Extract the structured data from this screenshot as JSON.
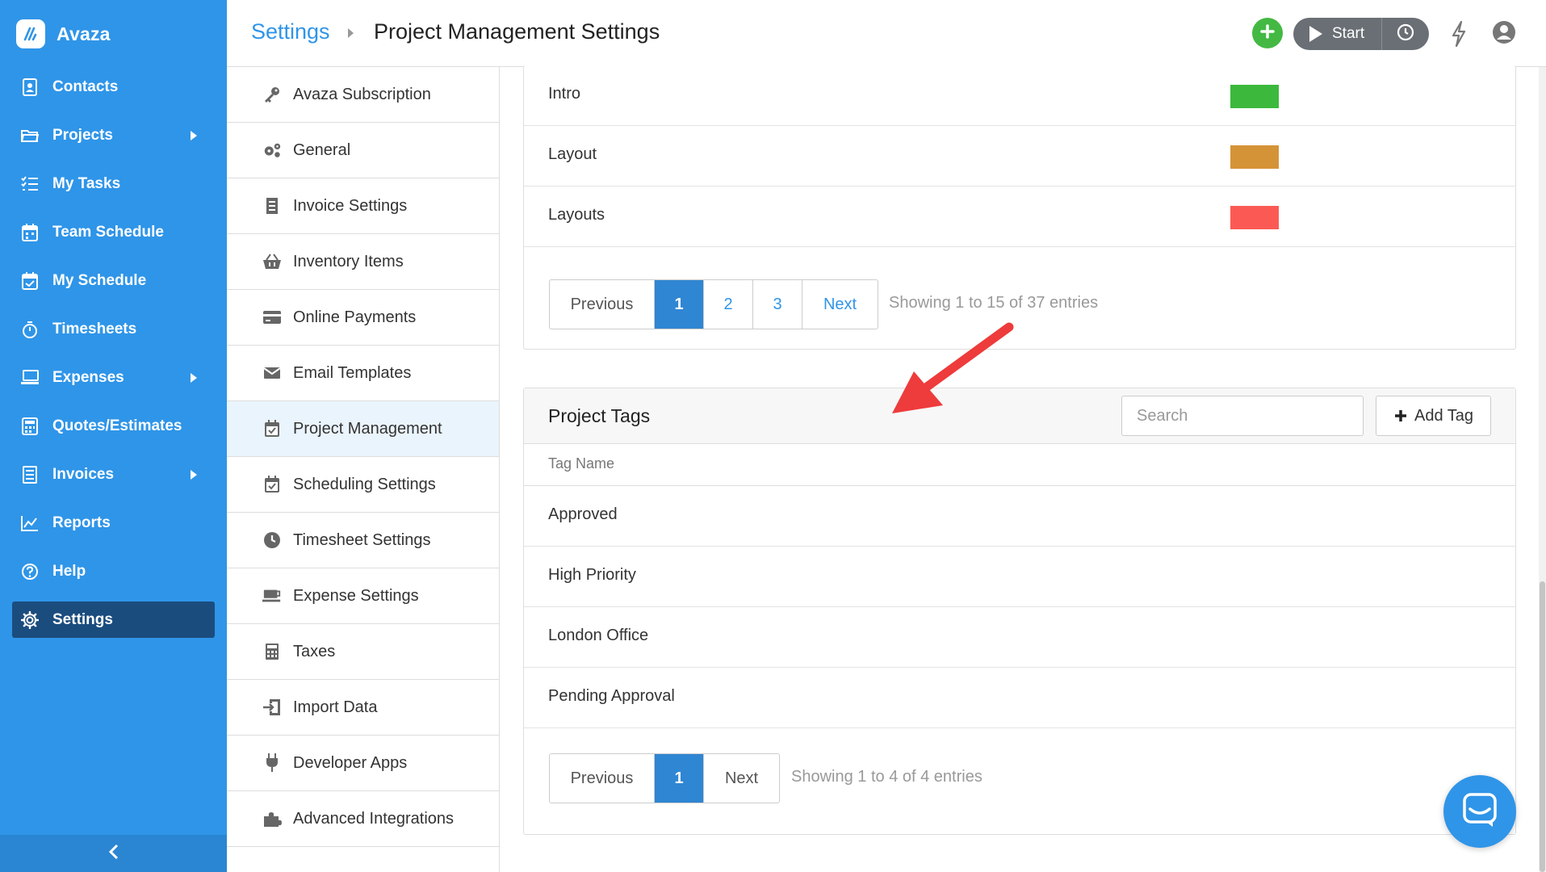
{
  "app": {
    "name": "Avaza"
  },
  "sidebar": {
    "items": [
      {
        "label": "Contacts",
        "icon": "contact-card-icon",
        "submenu": false
      },
      {
        "label": "Projects",
        "icon": "folder-icon",
        "submenu": true
      },
      {
        "label": "My Tasks",
        "icon": "task-list-icon",
        "submenu": false
      },
      {
        "label": "Team Schedule",
        "icon": "calendar-icon",
        "submenu": false
      },
      {
        "label": "My Schedule",
        "icon": "calendar-check-icon",
        "submenu": false
      },
      {
        "label": "Timesheets",
        "icon": "stopwatch-icon",
        "submenu": false
      },
      {
        "label": "Expenses",
        "icon": "receipt-icon",
        "submenu": true
      },
      {
        "label": "Quotes/Estimates",
        "icon": "calculator-icon",
        "submenu": false
      },
      {
        "label": "Invoices",
        "icon": "invoice-icon",
        "submenu": true
      },
      {
        "label": "Reports",
        "icon": "chart-icon",
        "submenu": false
      },
      {
        "label": "Help",
        "icon": "help-icon",
        "submenu": false
      },
      {
        "label": "Settings",
        "icon": "gear-icon",
        "submenu": false,
        "active": true
      }
    ]
  },
  "header": {
    "breadcrumb_root": "Settings",
    "breadcrumb_current": "Project Management Settings",
    "start_label": "Start"
  },
  "settings_menu": {
    "items": [
      {
        "label": "Avaza Subscription",
        "icon": "key-icon"
      },
      {
        "label": "General",
        "icon": "gears-icon"
      },
      {
        "label": "Invoice Settings",
        "icon": "invoice-icon"
      },
      {
        "label": "Inventory Items",
        "icon": "basket-icon"
      },
      {
        "label": "Online Payments",
        "icon": "credit-card-icon"
      },
      {
        "label": "Email Templates",
        "icon": "envelope-icon"
      },
      {
        "label": "Project Management",
        "icon": "calendar-check-icon",
        "active": true
      },
      {
        "label": "Scheduling Settings",
        "icon": "calendar-check-icon"
      },
      {
        "label": "Timesheet Settings",
        "icon": "clock-icon"
      },
      {
        "label": "Expense Settings",
        "icon": "coffee-icon"
      },
      {
        "label": "Taxes",
        "icon": "calculator-icon"
      },
      {
        "label": "Import Data",
        "icon": "import-icon"
      },
      {
        "label": "Developer Apps",
        "icon": "plug-icon"
      },
      {
        "label": "Advanced Integrations",
        "icon": "puzzle-icon"
      }
    ]
  },
  "categories_panel": {
    "rows": [
      {
        "name": "Intro",
        "color": "#3cb93c"
      },
      {
        "name": "Layout",
        "color": "#d59338"
      },
      {
        "name": "Layouts",
        "color": "#fb5a54"
      }
    ],
    "pagination": {
      "previous": "Previous",
      "pages": [
        "1",
        "2",
        "3"
      ],
      "active_page": "1",
      "next": "Next",
      "info": "Showing 1 to 15 of 37 entries"
    }
  },
  "tags_panel": {
    "title": "Project Tags",
    "search_placeholder": "Search",
    "add_label": "Add Tag",
    "column_header": "Tag Name",
    "rows": [
      "Approved",
      "High Priority",
      "London Office",
      "Pending Approval"
    ],
    "pagination": {
      "previous": "Previous",
      "pages": [
        "1"
      ],
      "active_page": "1",
      "next": "Next",
      "info": "Showing 1 to 4 of 4 entries"
    }
  },
  "colors": {
    "sidebar_bg": "#2f95e8",
    "sidebar_active": "#1b4c7e",
    "accent_blue": "#2f95e8",
    "add_green": "#43b943",
    "annotation_arrow": "#ee3b3b"
  }
}
